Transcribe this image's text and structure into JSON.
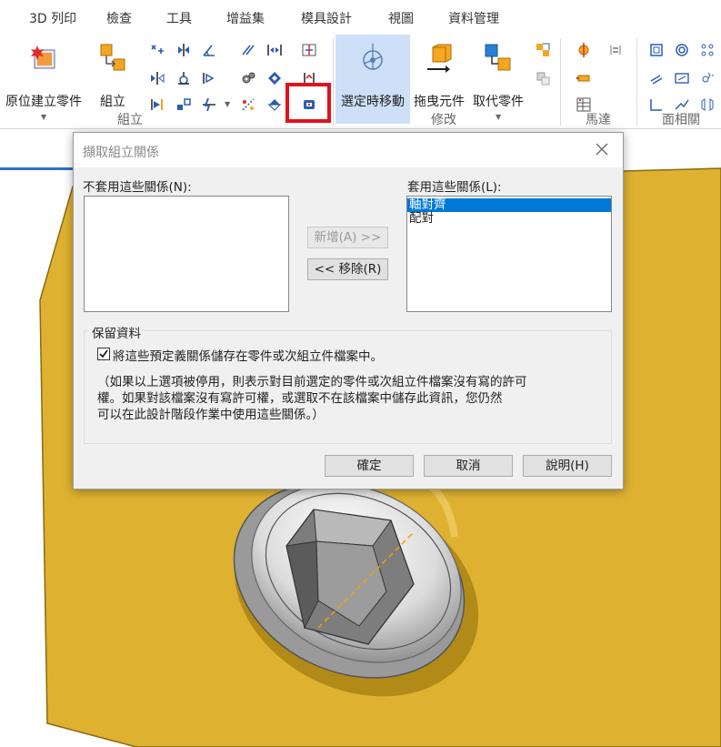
{
  "menu_tabs": [
    "3D 列印",
    "檢查",
    "工具",
    "增益集",
    "模具設計",
    "視圖",
    "資料管理"
  ],
  "ribbon": {
    "groups": {
      "assemble": "組立",
      "modify": "修改",
      "motor": "馬達",
      "face_relations": "面相關"
    },
    "buttons": {
      "create_in_place": "原位建立零件",
      "assemble": "組立",
      "move_on_select": "選定時移動",
      "drag_component": "拖曳元件",
      "replace_part": "取代零件"
    },
    "colors": {
      "highlight": "#e0121b",
      "selected_bg": "#cde0f7",
      "part_face": "#deb131"
    }
  },
  "dialog": {
    "title": "擷取組立關係",
    "not_apply_label": "不套用這些關係(N):",
    "apply_label": "套用這些關係(L):",
    "not_apply_items": [],
    "apply_items": [
      "軸對齊",
      "配對"
    ],
    "selected_item": "軸對齊",
    "add_button": "新增(A) >>",
    "remove_button": "<< 移除(R)",
    "keep_group_label": "保留資料",
    "checkbox_label": "將這些預定義關係儲存在零件或次組立件檔案中。",
    "checkbox_checked": true,
    "note_lines": [
      "（如果以上選項被停用，則表示對目前選定的零件或次組立件檔案沒有寫的許可",
      "權。如果對該檔案沒有寫許可權，或選取不在該檔案中儲存此資訊，您仍然",
      "可以在此設計階段作業中使用這些關係。）"
    ],
    "ok_button": "確定",
    "cancel_button": "取消",
    "help_button": "說明(H)"
  }
}
